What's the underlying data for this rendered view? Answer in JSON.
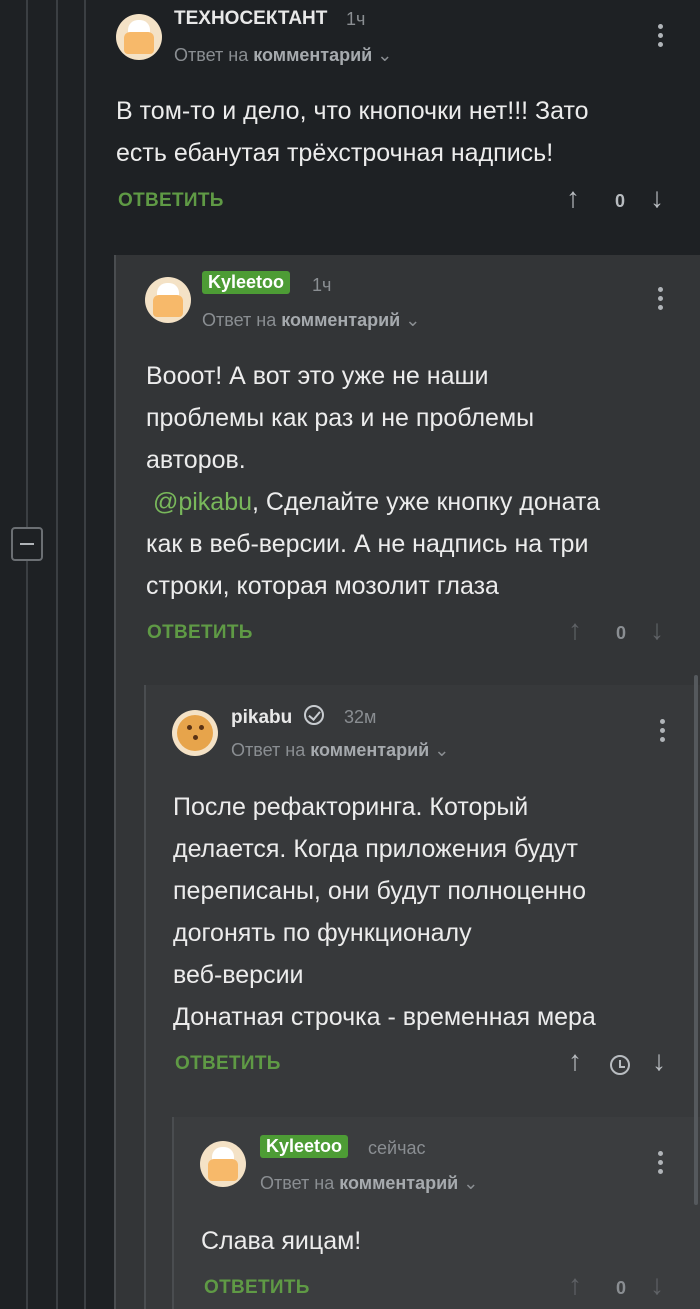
{
  "comments": [
    {
      "author": "ТЕХНОСЕКТАНТ",
      "time": "1ч",
      "reply_prefix": "Ответ на",
      "reply_target": "комментарий",
      "text_lines": [
        "В том-то и дело, что кнопочки нет!!! Зато",
        "есть ебанутая трёхстрочная надпись!"
      ],
      "reply_label": "ОТВЕТИТЬ",
      "score": "0"
    },
    {
      "author": "Kyleetoo",
      "time": "1ч",
      "reply_prefix": "Ответ на",
      "reply_target": "комментарий",
      "text_lines": [
        "Вооот! А вот это уже не наши",
        "проблемы как раз и не проблемы",
        "авторов."
      ],
      "mention": "@pikabu",
      "text_after_mention": ", Сделайте уже кнопку доната",
      "text_lines_2": [
        "как в веб-версии. А не надпись на три",
        "строки, которая мозолит глаза"
      ],
      "reply_label": "ОТВЕТИТЬ",
      "score": "0"
    },
    {
      "author": "pikabu",
      "time": "32м",
      "reply_prefix": "Ответ на",
      "reply_target": "комментарий",
      "text_lines": [
        "После рефакторинга. Который",
        "делается. Когда приложения будут",
        "переписаны, они будут полноценно",
        "догонять по функционалу",
        "веб-версии",
        "Донатная строчка - временная мера"
      ],
      "reply_label": "ОТВЕТИТЬ"
    },
    {
      "author": "Kyleetoo",
      "time": "сейчас",
      "reply_prefix": "Ответ на",
      "reply_target": "комментарий",
      "text_lines": [
        "Слава яицам!"
      ],
      "reply_label": "ОТВЕТИТЬ",
      "score": "0"
    }
  ],
  "icons": {
    "upvote": "↑",
    "downvote": "↓"
  }
}
